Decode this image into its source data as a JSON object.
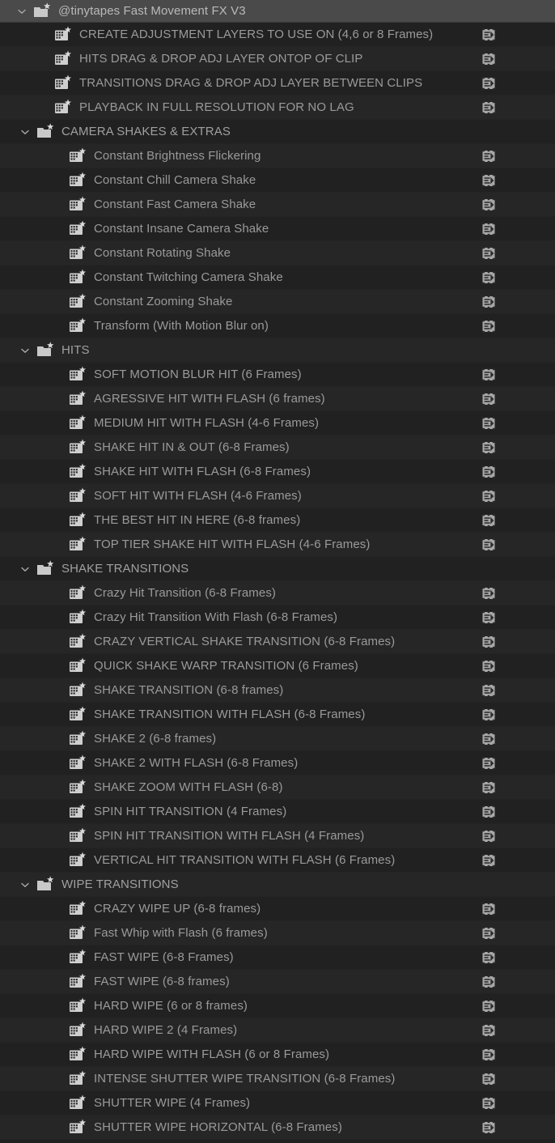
{
  "panel": {
    "title": "@tinytapes Fast Movement FX V3",
    "colors": {
      "header_bg": "#4a4a4a",
      "row_odd_bg": "#212121",
      "row_even_bg": "#262626",
      "text": "#9a9a9a",
      "header_text": "#b9b9b9",
      "icon": "#c8c8c8"
    },
    "icons": {
      "chevron": "chevron-down-icon",
      "folder": "bin-folder-star-icon",
      "clip": "clip-star-icon",
      "speed": "speed-badge-icon"
    }
  },
  "rows": [
    {
      "type": "header",
      "indent": "h",
      "label": "@tinytapes Fast Movement FX V3",
      "icon": "folder",
      "chevron": true,
      "speed": false
    },
    {
      "type": "clip",
      "indent": "1",
      "label": "CREATE ADJUSTMENT LAYERS TO USE ON (4,6 or 8 Frames)",
      "icon": "clip",
      "chevron": false,
      "speed": true
    },
    {
      "type": "clip",
      "indent": "1",
      "label": "HITS DRAG & DROP ADJ LAYER ONTOP OF CLIP",
      "icon": "clip",
      "chevron": false,
      "speed": true
    },
    {
      "type": "clip",
      "indent": "1",
      "label": "TRANSITIONS DRAG & DROP ADJ LAYER BETWEEN CLIPS",
      "icon": "clip",
      "chevron": false,
      "speed": true
    },
    {
      "type": "clip",
      "indent": "1",
      "label": "PLAYBACK IN FULL RESOLUTION FOR NO LAG",
      "icon": "clip",
      "chevron": false,
      "speed": true
    },
    {
      "type": "folder",
      "indent": "f1",
      "label": "CAMERA SHAKES & EXTRAS",
      "icon": "folder",
      "chevron": true,
      "speed": false
    },
    {
      "type": "clip",
      "indent": "2",
      "label": "Constant Brightness Flickering",
      "icon": "clip",
      "chevron": false,
      "speed": true
    },
    {
      "type": "clip",
      "indent": "2",
      "label": "Constant Chill Camera Shake",
      "icon": "clip",
      "chevron": false,
      "speed": true
    },
    {
      "type": "clip",
      "indent": "2",
      "label": "Constant Fast Camera Shake",
      "icon": "clip",
      "chevron": false,
      "speed": true
    },
    {
      "type": "clip",
      "indent": "2",
      "label": "Constant Insane Camera Shake",
      "icon": "clip",
      "chevron": false,
      "speed": true
    },
    {
      "type": "clip",
      "indent": "2",
      "label": "Constant Rotating Shake",
      "icon": "clip",
      "chevron": false,
      "speed": true
    },
    {
      "type": "clip",
      "indent": "2",
      "label": "Constant Twitching Camera Shake",
      "icon": "clip",
      "chevron": false,
      "speed": true
    },
    {
      "type": "clip",
      "indent": "2",
      "label": "Constant Zooming Shake",
      "icon": "clip",
      "chevron": false,
      "speed": true
    },
    {
      "type": "clip",
      "indent": "2",
      "label": "Transform (With Motion Blur on)",
      "icon": "clip",
      "chevron": false,
      "speed": true
    },
    {
      "type": "folder",
      "indent": "f1",
      "label": "HITS",
      "icon": "folder",
      "chevron": true,
      "speed": false
    },
    {
      "type": "clip",
      "indent": "2",
      "label": "SOFT MOTION BLUR HIT (6 Frames)",
      "icon": "clip",
      "chevron": false,
      "speed": true
    },
    {
      "type": "clip",
      "indent": "2",
      "label": "AGRESSIVE HIT WITH FLASH (6 frames)",
      "icon": "clip",
      "chevron": false,
      "speed": true
    },
    {
      "type": "clip",
      "indent": "2",
      "label": "MEDIUM HIT WITH FLASH (4-6 Frames)",
      "icon": "clip",
      "chevron": false,
      "speed": true
    },
    {
      "type": "clip",
      "indent": "2",
      "label": "SHAKE HIT IN & OUT (6-8 Frames)",
      "icon": "clip",
      "chevron": false,
      "speed": true
    },
    {
      "type": "clip",
      "indent": "2",
      "label": "SHAKE HIT WITH FLASH (6-8 Frames)",
      "icon": "clip",
      "chevron": false,
      "speed": true
    },
    {
      "type": "clip",
      "indent": "2",
      "label": "SOFT HIT WITH FLASH (4-6 Frames)",
      "icon": "clip",
      "chevron": false,
      "speed": true
    },
    {
      "type": "clip",
      "indent": "2",
      "label": "THE BEST HIT IN HERE (6-8 frames)",
      "icon": "clip",
      "chevron": false,
      "speed": true
    },
    {
      "type": "clip",
      "indent": "2",
      "label": "TOP TIER SHAKE HIT WITH FLASH (4-6 Frames)",
      "icon": "clip",
      "chevron": false,
      "speed": true
    },
    {
      "type": "folder",
      "indent": "f1",
      "label": "SHAKE TRANSITIONS",
      "icon": "folder",
      "chevron": true,
      "speed": false
    },
    {
      "type": "clip",
      "indent": "2",
      "label": "Crazy Hit Transition (6-8 Frames)",
      "icon": "clip",
      "chevron": false,
      "speed": true
    },
    {
      "type": "clip",
      "indent": "2",
      "label": "Crazy Hit Transition With Flash (6-8 Frames)",
      "icon": "clip",
      "chevron": false,
      "speed": true
    },
    {
      "type": "clip",
      "indent": "2",
      "label": "CRAZY VERTICAL SHAKE TRANSITION (6-8 Frames)",
      "icon": "clip",
      "chevron": false,
      "speed": true
    },
    {
      "type": "clip",
      "indent": "2",
      "label": "QUICK SHAKE WARP TRANSITION (6 Frames)",
      "icon": "clip",
      "chevron": false,
      "speed": true
    },
    {
      "type": "clip",
      "indent": "2",
      "label": "SHAKE TRANSITION (6-8 frames)",
      "icon": "clip",
      "chevron": false,
      "speed": true
    },
    {
      "type": "clip",
      "indent": "2",
      "label": "SHAKE TRANSITION WITH FLASH (6-8 Frames)",
      "icon": "clip",
      "chevron": false,
      "speed": true
    },
    {
      "type": "clip",
      "indent": "2",
      "label": "SHAKE 2 (6-8 frames)",
      "icon": "clip",
      "chevron": false,
      "speed": true
    },
    {
      "type": "clip",
      "indent": "2",
      "label": "SHAKE 2 WITH FLASH (6-8 Frames)",
      "icon": "clip",
      "chevron": false,
      "speed": true
    },
    {
      "type": "clip",
      "indent": "2",
      "label": "SHAKE ZOOM WITH FLASH (6-8)",
      "icon": "clip",
      "chevron": false,
      "speed": true
    },
    {
      "type": "clip",
      "indent": "2",
      "label": "SPIN HIT TRANSITION (4 Frames)",
      "icon": "clip",
      "chevron": false,
      "speed": true
    },
    {
      "type": "clip",
      "indent": "2",
      "label": "SPIN HIT TRANSITION WITH FLASH (4 Frames)",
      "icon": "clip",
      "chevron": false,
      "speed": true
    },
    {
      "type": "clip",
      "indent": "2",
      "label": "VERTICAL HIT TRANSITION WITH FLASH (6 Frames)",
      "icon": "clip",
      "chevron": false,
      "speed": true
    },
    {
      "type": "folder",
      "indent": "f1",
      "label": "WIPE TRANSITIONS",
      "icon": "folder",
      "chevron": true,
      "speed": false
    },
    {
      "type": "clip",
      "indent": "2",
      "label": "CRAZY WIPE UP (6-8 frames)",
      "icon": "clip",
      "chevron": false,
      "speed": true
    },
    {
      "type": "clip",
      "indent": "2",
      "label": "Fast Whip with Flash (6 frames)",
      "icon": "clip",
      "chevron": false,
      "speed": true
    },
    {
      "type": "clip",
      "indent": "2",
      "label": "FAST WIPE (6-8 Frames)",
      "icon": "clip",
      "chevron": false,
      "speed": true
    },
    {
      "type": "clip",
      "indent": "2",
      "label": "FAST WIPE (6-8 frames)",
      "icon": "clip",
      "chevron": false,
      "speed": true
    },
    {
      "type": "clip",
      "indent": "2",
      "label": "HARD WIPE (6 or 8 frames)",
      "icon": "clip",
      "chevron": false,
      "speed": true
    },
    {
      "type": "clip",
      "indent": "2",
      "label": "HARD WIPE 2 (4 Frames)",
      "icon": "clip",
      "chevron": false,
      "speed": true
    },
    {
      "type": "clip",
      "indent": "2",
      "label": "HARD WIPE WITH FLASH (6 or 8 Frames)",
      "icon": "clip",
      "chevron": false,
      "speed": true
    },
    {
      "type": "clip",
      "indent": "2",
      "label": "INTENSE SHUTTER WIPE TRANSITION (6-8 Frames)",
      "icon": "clip",
      "chevron": false,
      "speed": true
    },
    {
      "type": "clip",
      "indent": "2",
      "label": "SHUTTER WIPE (4 Frames)",
      "icon": "clip",
      "chevron": false,
      "speed": true
    },
    {
      "type": "clip",
      "indent": "2",
      "label": "SHUTTER WIPE HORIZONTAL (6-8 Frames)",
      "icon": "clip",
      "chevron": false,
      "speed": true
    }
  ]
}
